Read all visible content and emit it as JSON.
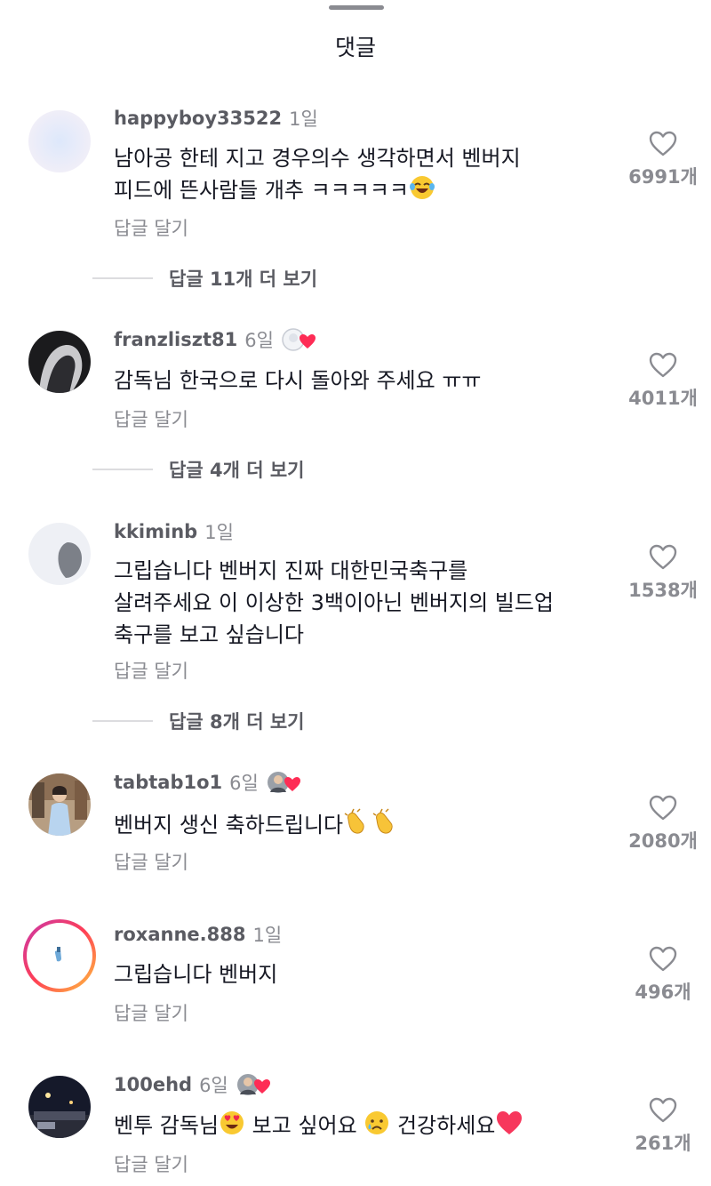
{
  "sheet": {
    "title": "댓글"
  },
  "colors": {
    "heart": "#fe2c55",
    "text": "#161823",
    "muted": "#8a8b91"
  },
  "comments": [
    {
      "username": "happyboy33522",
      "time": "1일",
      "lines": [
        "남아공 한테 지고 경우의수 생각하면서 벤버지",
        "피드에 뜬사람들 개추 ㅋㅋㅋㅋㅋ"
      ],
      "emoji": "face-with-tears-of-joy-emoji",
      "reply_label": "답글 달기",
      "likes": "6991개",
      "more_replies": "답글 11개 더 보기"
    },
    {
      "username": "franzliszt81",
      "time": "6일",
      "badge": "creator-liked-heart",
      "lines": [
        "감독님 한국으로 다시 돌아와 주세요 ㅠㅠ"
      ],
      "reply_label": "답글 달기",
      "likes": "4011개",
      "more_replies": "답글 4개 더 보기"
    },
    {
      "username": "kkiminb",
      "time": "1일",
      "lines": [
        "그립습니다 벤버지 진짜 대한민국축구를",
        "살려주세요 이 이상한 3백이아닌 벤버지의 빌드업",
        "축구를 보고 싶습니다"
      ],
      "reply_label": "답글 달기",
      "likes": "1538개",
      "more_replies": "답글 8개 더 보기"
    },
    {
      "username": "tabtab1o1",
      "time": "6일",
      "badge": "creator-liked-heart",
      "lines": [
        "벤버지 생신 축하드립니다"
      ],
      "emoji": "clapping-hands-emoji",
      "reply_label": "답글 달기",
      "likes": "2080개"
    },
    {
      "username": "roxanne.888",
      "time": "1일",
      "lines": [
        "그립습니다 벤버지"
      ],
      "reply_label": "답글 달기",
      "likes": "496개"
    },
    {
      "username": "100ehd",
      "time": "6일",
      "badge": "creator-liked-heart",
      "parts": [
        "벤투 감독님",
        " 보고 싶어요 ",
        " 건강하세요"
      ],
      "emojis": [
        "heart-eyes-emoji",
        "crying-face-emoji",
        "red-heart-emoji"
      ],
      "reply_label": "답글 달기",
      "likes": "261개"
    }
  ]
}
